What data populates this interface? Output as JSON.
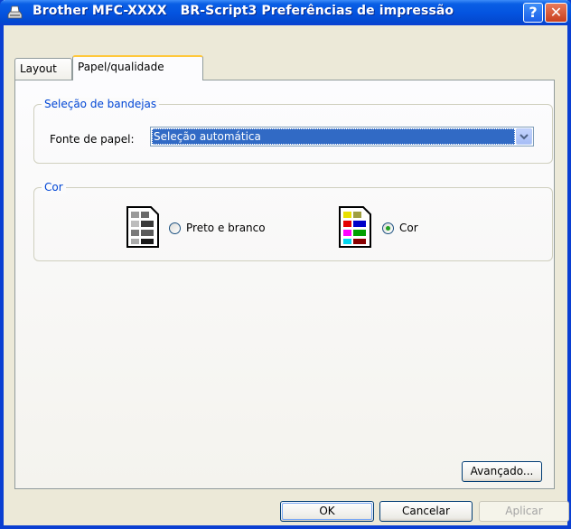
{
  "window": {
    "title": "Brother MFC-XXXX   BR-Script3 Preferências de impressão",
    "help_label": "?",
    "close_label": "✕"
  },
  "tabs": [
    {
      "label": "Layout",
      "selected": false
    },
    {
      "label": "Papel/qualidade",
      "selected": true
    }
  ],
  "tray_selection": {
    "group_label": "Seleção de bandejas",
    "paper_source_label": "Fonte de papel:",
    "paper_source_value": "Seleção automática"
  },
  "color": {
    "group_label": "Cor",
    "options": [
      {
        "label": "Preto e branco",
        "selected": false,
        "icon": "grayscale-page-icon"
      },
      {
        "label": "Cor",
        "selected": true,
        "icon": "color-page-icon"
      }
    ]
  },
  "buttons": {
    "advanced": "Avançado...",
    "ok": "OK",
    "cancel": "Cancelar",
    "apply": "Aplicar"
  }
}
